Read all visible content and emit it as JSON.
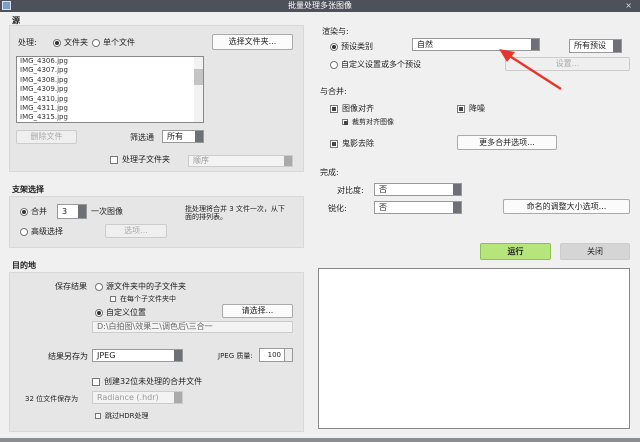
{
  "window": {
    "title": "批量处理多张图像",
    "close": "×"
  },
  "source": {
    "heading": "源",
    "process_label": "处理:",
    "opt_folder": "文件夹",
    "opt_single": "单个文件",
    "choose_folder": "选择文件夹...",
    "files": [
      "IMG_4306.jpg",
      "IMG_4307.jpg",
      "IMG_4308.jpg",
      "IMG_4309.jpg",
      "IMG_4310.jpg",
      "IMG_4311.jpg",
      "IMG_4315.jpg"
    ],
    "remove_files": "删除文件",
    "filter_label": "筛选通",
    "filter_value": "所有",
    "subfolders_label": "处理子文件夹",
    "order_value": "顺序"
  },
  "bracket": {
    "heading": "支架选择",
    "merge_label": "合并",
    "merge_count": "3",
    "merge_suffix": "一次图像",
    "advanced_label": "高级选择",
    "options_button": "选项...",
    "info": "批处理将合并 3 文件一次，从下面的排列表。"
  },
  "destination": {
    "heading": "目的地",
    "save_label": "保存结果",
    "opt_subfolder": "源文件夹中的子文件夹",
    "each_subfolder": "在每个子文件夹中",
    "opt_custom": "自定义位置",
    "browse": "请选择...",
    "path": "D:\\白拍图\\效果二\\调色后\\三合一",
    "save_as_label": "结果另存为",
    "save_as_value": "JPEG",
    "quality_label": "JPEG 质量:",
    "quality_value": "100",
    "create32": "创建32位未处理的合并文件",
    "save32_label": "32 位文件保存为",
    "save32_value": "Radiance (.hdr)",
    "skip_hdr": "跳过HDR处理"
  },
  "render": {
    "heading": "渲染与:",
    "preset_category_label": "预设类别",
    "preset_value": "自然",
    "all_presets": "所有预设",
    "custom_label": "自定义设置或多个预设",
    "settings_button": "设置..."
  },
  "merge": {
    "heading": "与合并:",
    "align": "图像对齐",
    "denoise": "降噪",
    "crop_aligned": "裁剪对齐图像",
    "deghost": "鬼影去除",
    "more_options": "更多合并选项..."
  },
  "finish": {
    "heading": "完成:",
    "contrast_label": "对比度:",
    "contrast_value": "否",
    "sharpen_label": "锐化:",
    "sharpen_value": "否",
    "resize_options": "命名的调整大小选项..."
  },
  "actions": {
    "run": "运行",
    "close": "关闭"
  },
  "annotation": {
    "arrow_color": "#e8352b"
  }
}
